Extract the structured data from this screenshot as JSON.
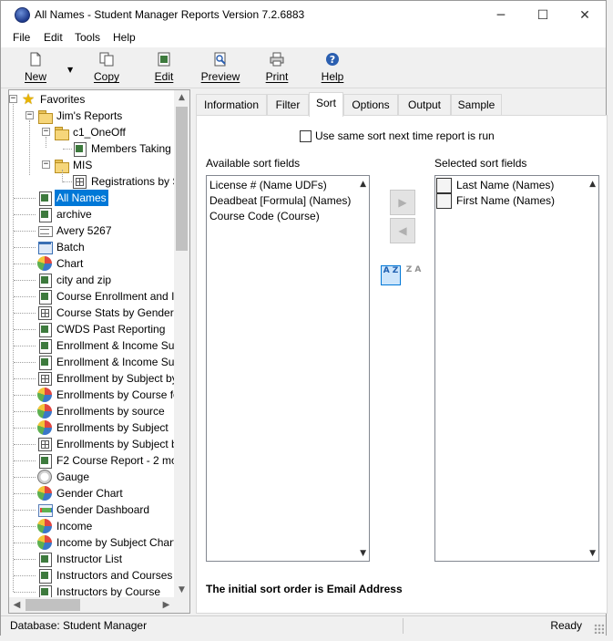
{
  "window": {
    "title": "All Names - Student Manager Reports Version 7.2.6883",
    "minimize": "─",
    "maximize": "☐",
    "close": "✕"
  },
  "menu": [
    "File",
    "Edit",
    "Tools",
    "Help"
  ],
  "toolbar": {
    "new_label": "New",
    "copy_label": "Copy",
    "edit_label": "Edit",
    "preview_label": "Preview",
    "print_label": "Print",
    "help_label": "Help",
    "dropdown_arrow": "▼"
  },
  "tree": {
    "favorites": "Favorites",
    "jims_reports": "Jim's Reports",
    "c1_oneoff": "c1_OneOff",
    "members_taking": "Members Taking",
    "mis": "MIS",
    "registrations": "Registrations by S",
    "items": [
      {
        "label": "All Names",
        "icon": "report-icon"
      },
      {
        "label": "archive",
        "icon": "report-icon"
      },
      {
        "label": "Avery 5267",
        "icon": "label-icon"
      },
      {
        "label": "Batch",
        "icon": "batch-icon"
      },
      {
        "label": "Chart",
        "icon": "pie-chart-icon"
      },
      {
        "label": "city and zip",
        "icon": "report-icon"
      },
      {
        "label": "Course Enrollment and In",
        "icon": "report-icon"
      },
      {
        "label": "Course Stats by Gender",
        "icon": "crosstab-icon"
      },
      {
        "label": "CWDS Past Reporting",
        "icon": "report-icon"
      },
      {
        "label": "Enrollment & Income Su",
        "icon": "report-icon"
      },
      {
        "label": "Enrollment & Income Su",
        "icon": "report-icon"
      },
      {
        "label": "Enrollment by Subject by",
        "icon": "crosstab-icon"
      },
      {
        "label": "Enrollments by Course fo",
        "icon": "pie-chart-icon"
      },
      {
        "label": "Enrollments by source",
        "icon": "pie-chart-icon"
      },
      {
        "label": "Enrollments by Subject",
        "icon": "pie-chart-icon"
      },
      {
        "label": "Enrollments by Subject b",
        "icon": "crosstab-icon"
      },
      {
        "label": "F2 Course Report - 2 mo",
        "icon": "report-icon"
      },
      {
        "label": "Gauge",
        "icon": "gauge-icon"
      },
      {
        "label": "Gender Chart",
        "icon": "pie-chart-icon"
      },
      {
        "label": "Gender Dashboard",
        "icon": "dashboard-icon"
      },
      {
        "label": "Income",
        "icon": "pie-chart-icon"
      },
      {
        "label": "Income by Subject Chart",
        "icon": "pie-chart-icon"
      },
      {
        "label": "Instructor List",
        "icon": "report-icon"
      },
      {
        "label": "Instructors and Courses T",
        "icon": "report-icon"
      },
      {
        "label": "Instructors by Course",
        "icon": "report-icon"
      }
    ]
  },
  "tabs": [
    "Information",
    "Filter",
    "Sort",
    "Options",
    "Output",
    "Sample"
  ],
  "active_tab": "Sort",
  "sort": {
    "same_sort_label": "Use same sort next time report is run",
    "available_label": "Available sort fields",
    "selected_label": "Selected sort fields",
    "available_fields": [
      "License # (Name UDFs)",
      "Deadbeat [Formula] (Names)",
      "Course Code (Course)"
    ],
    "selected_fields": [
      "Last Name (Names)",
      "First Name (Names)"
    ],
    "add_arrow": "▶",
    "remove_arrow": "◀",
    "asc_glyph": "A Z",
    "desc_glyph": "Z A",
    "note": "The initial sort order is Email Address"
  },
  "status": {
    "database": "Database: Student Manager",
    "state": "Ready"
  },
  "colors": {
    "selection": "#0078d7",
    "window_bg": "#f0f0f0"
  }
}
